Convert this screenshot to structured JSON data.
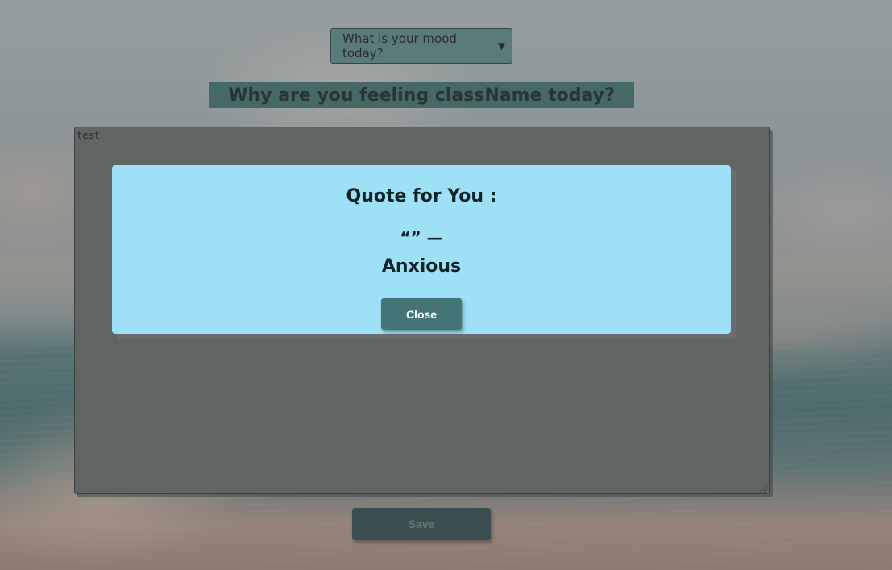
{
  "mood_select": {
    "selected": "What is your mood today?"
  },
  "heading": {
    "text": "Why are you feeling className today?"
  },
  "journal": {
    "value": "test"
  },
  "save_button": {
    "label": "Save"
  },
  "modal": {
    "title": "Quote for You :",
    "quote": "“” —",
    "author": "Anxious",
    "close_label": "Close"
  },
  "colors": {
    "select_bg": "#5f9a96",
    "heading_band": "#3f7a78",
    "modal_bg": "#9ee0f5",
    "close_button": "#447576",
    "save_button": "#2d4f50"
  }
}
